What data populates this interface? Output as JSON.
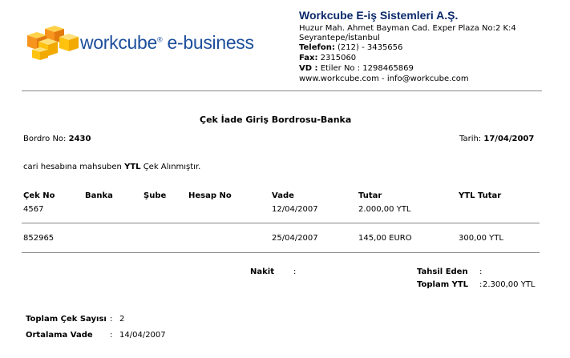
{
  "logo": {
    "brand": "workcube",
    "registered": "®",
    "suffix": " e-business"
  },
  "company": {
    "name": "Workcube E-iş Sistemleri A.Ş.",
    "address1": "Huzur Mah. Ahmet Bayman Cad. Exper Plaza No:2 K:4",
    "address2": "Seyrantepe/İstanbul",
    "phone_label": "Telefon:",
    "phone_value": " (212) - 3435656",
    "fax_label": "Fax:",
    "fax_value": " 2315060",
    "vd_label": "VD :",
    "vd_value": " Etiler No : 1298465869",
    "web": "www.workcube.com - info@workcube.com"
  },
  "document": {
    "title": "Çek İade Giriş Bordrosu-Banka",
    "bordro_label": "Bordro No:",
    "bordro_no": "2430",
    "date_label": "Tarih:",
    "date": "17/04/2007",
    "note_prefix": "cari hesabına mahsuben ",
    "note_currency": "YTL",
    "note_suffix": " Çek Alınmıştır."
  },
  "table": {
    "headers": [
      "Çek No",
      "Banka",
      "Şube",
      "Hesap No",
      "Vade",
      "Tutar",
      "YTL Tutar"
    ],
    "rows": [
      {
        "cek_no": "4567",
        "banka": "",
        "sube": "",
        "hesap_no": "",
        "vade": "12/04/2007",
        "tutar": "2.000,00 YTL",
        "ytl_tutar": ""
      },
      {
        "cek_no": "852965",
        "banka": "",
        "sube": "",
        "hesap_no": "",
        "vade": "25/04/2007",
        "tutar": "145,00 EURO",
        "ytl_tutar": "300,00 YTL"
      }
    ]
  },
  "summary": {
    "nakit_label": "Nakit",
    "nakit_sep": ":",
    "nakit_value": "",
    "tahsil_label": "Tahsil Eden",
    "tahsil_sep": ":",
    "tahsil_value": "",
    "toplam_label": "Toplam YTL",
    "toplam_sep": ":",
    "toplam_value": " 2.300,00 YTL"
  },
  "footer": {
    "cek_sayisi_label": "Toplam Çek Sayısı",
    "cek_sayisi_sep": ":",
    "cek_sayisi_value": "2",
    "ortalama_label": "Ortalama Vade",
    "ortalama_sep": ":",
    "ortalama_value": "14/04/2007"
  },
  "colors": {
    "brand_blue": "#1e4f9c",
    "cube_orange": "#f7941d",
    "cube_yellow": "#ffc20e"
  }
}
